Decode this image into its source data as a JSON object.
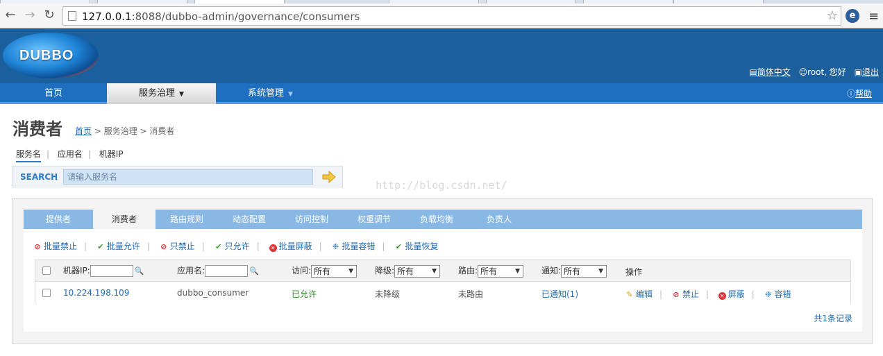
{
  "browser": {
    "url_host": "127.0.0.1",
    "url_rest": ":8088/dubbo-admin/governance/consumers"
  },
  "header": {
    "logo_text": "DUBBO",
    "language": "简体中文",
    "user_greeting": "root, 您好",
    "logout": "退出"
  },
  "nav": {
    "items": [
      {
        "label": "首页"
      },
      {
        "label": "服务治理"
      },
      {
        "label": "系统管理"
      }
    ],
    "help": "帮助"
  },
  "page": {
    "title": "消费者",
    "breadcrumb": {
      "home": "首页",
      "sep1": " > ",
      "mid": "服务治理",
      "sep2": " > ",
      "current": "消费者"
    }
  },
  "search": {
    "tabs": [
      "服务名",
      "应用名",
      "机器IP"
    ],
    "label": "SEARCH",
    "placeholder": "请输入服务名"
  },
  "watermark": "http://blog.csdn.net/",
  "content_tabs": [
    "提供者",
    "消费者",
    "路由规则",
    "动态配置",
    "访问控制",
    "权重调节",
    "负载均衡",
    "负责人"
  ],
  "actions": [
    "批量禁止",
    "批量允许",
    "只禁止",
    "只允许",
    "批量屏蔽",
    "批量容错",
    "批量恢复"
  ],
  "table": {
    "headers": {
      "ip": "机器IP:",
      "app": "应用名:",
      "access": "访问:",
      "degrade": "降级:",
      "route": "路由:",
      "notify": "通知:",
      "ops": "操作"
    },
    "filter_all": "所有",
    "rows": [
      {
        "ip": "10.224.198.109",
        "app": "dubbo_consumer",
        "access": "已允许",
        "degrade": "未降级",
        "route": "未路由",
        "notify": "已通知(1)",
        "ops": [
          "编辑",
          "禁止",
          "屏蔽",
          "容错"
        ]
      }
    ],
    "total": "共1条记录"
  }
}
